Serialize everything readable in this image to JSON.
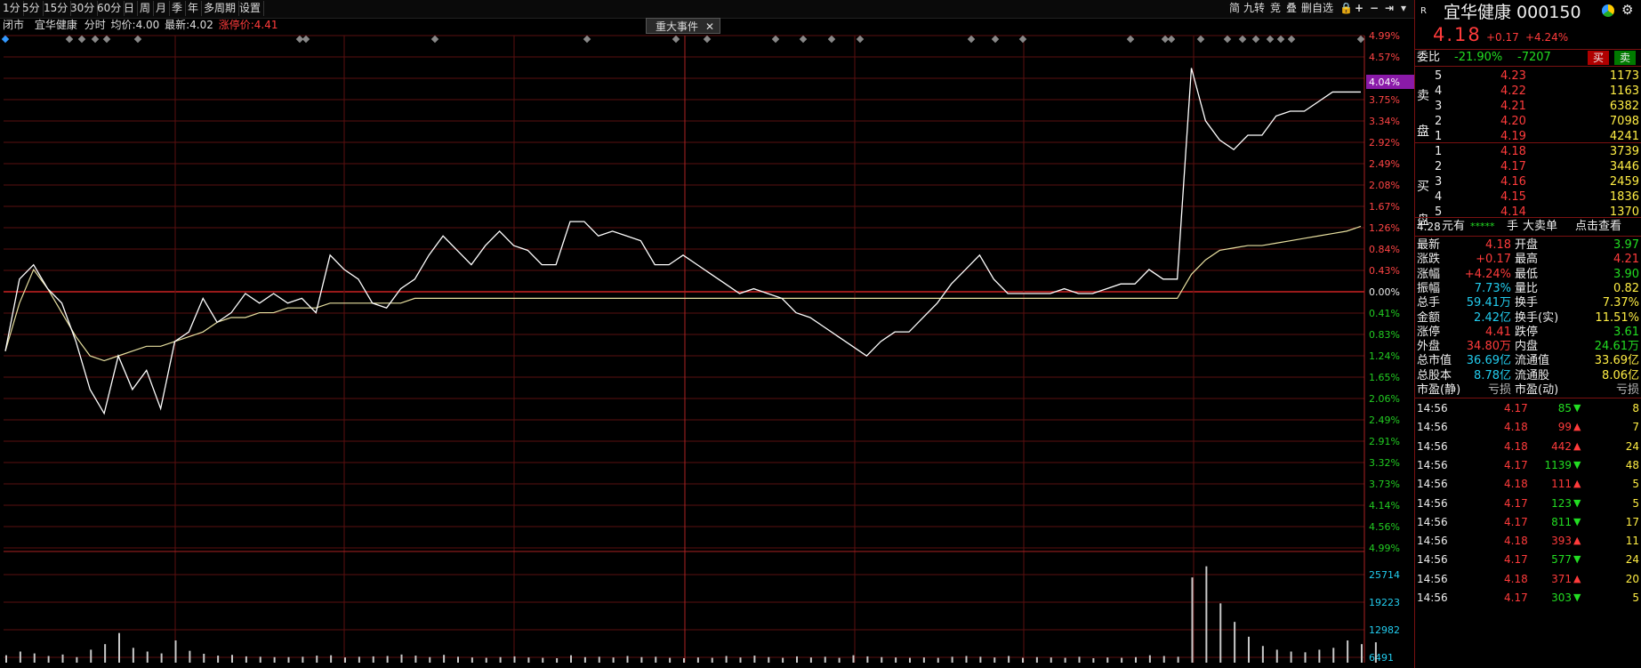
{
  "toolbar": {
    "periods": [
      "1分",
      "5分",
      "15分",
      "30分",
      "60分",
      "日",
      "周",
      "月",
      "季",
      "年",
      "多周期",
      "设置"
    ],
    "right_tools": [
      "简",
      "九转",
      "竞",
      "叠",
      "删自选"
    ]
  },
  "infobar": {
    "mode": "闭市",
    "name": "宜华健康",
    "type": "分时",
    "avg_label": "均价:",
    "avg": "4.00",
    "last_label": "最新:",
    "last": "4.02",
    "limit_label": "涨停价:",
    "limit": "4.41"
  },
  "event_tab": "重大事件",
  "chart_data": {
    "type": "line",
    "title": "",
    "price_axis_labels": [
      "4.99%",
      "4.57%",
      "4.04%",
      "3.75%",
      "3.34%",
      "2.92%",
      "2.49%",
      "2.08%",
      "1.67%",
      "1.26%",
      "0.84%",
      "0.43%",
      "0.00%",
      "0.41%",
      "0.83%",
      "1.24%",
      "1.65%",
      "2.06%",
      "2.49%",
      "2.91%",
      "3.32%",
      "3.73%",
      "4.14%",
      "4.56%",
      "4.99%"
    ],
    "current_label": "4.04%",
    "volume_axis_labels": [
      "25714",
      "19223",
      "12982",
      "6491"
    ],
    "price_y": [
      -1.2,
      0.3,
      0.6,
      0.1,
      -0.2,
      -1.0,
      -2.0,
      -2.5,
      -1.3,
      -2.0,
      -1.6,
      -2.4,
      -1.0,
      -0.8,
      -0.1,
      -0.6,
      -0.4,
      0.0,
      -0.2,
      0.0,
      -0.2,
      -0.1,
      -0.4,
      0.8,
      0.5,
      0.3,
      -0.2,
      -0.3,
      0.1,
      0.3,
      0.8,
      1.2,
      0.9,
      0.6,
      1.0,
      1.3,
      1.0,
      0.9,
      0.6,
      0.6,
      1.5,
      1.5,
      1.2,
      1.3,
      1.2,
      1.1,
      0.6,
      0.6,
      0.8,
      0.6,
      0.4,
      0.2,
      0.0,
      0.1,
      0.0,
      -0.1,
      -0.4,
      -0.5,
      -0.7,
      -0.9,
      -1.1,
      -1.3,
      -1.0,
      -0.8,
      -0.8,
      -0.5,
      -0.2,
      0.2,
      0.5,
      0.8,
      0.3,
      0.0,
      0.0,
      0.0,
      0.0,
      0.1,
      0.0,
      0.0,
      0.1,
      0.2,
      0.2,
      0.5,
      0.3,
      0.3,
      4.7,
      3.6,
      3.2,
      3.0,
      3.3,
      3.3,
      3.7,
      3.8,
      3.8,
      4.0,
      4.2,
      4.2,
      4.2
    ],
    "avg_y": [
      -1.2,
      -0.2,
      0.5,
      0.1,
      -0.4,
      -0.9,
      -1.3,
      -1.4,
      -1.3,
      -1.2,
      -1.1,
      -1.1,
      -1.0,
      -0.9,
      -0.8,
      -0.6,
      -0.5,
      -0.5,
      -0.4,
      -0.4,
      -0.3,
      -0.3,
      -0.3,
      -0.2,
      -0.2,
      -0.2,
      -0.2,
      -0.2,
      -0.2,
      -0.1,
      -0.1,
      -0.1,
      -0.1,
      -0.1,
      -0.1,
      -0.1,
      -0.1,
      -0.1,
      -0.1,
      -0.1,
      -0.1,
      -0.1,
      -0.1,
      -0.1,
      -0.1,
      -0.1,
      -0.1,
      -0.1,
      -0.1,
      -0.1,
      -0.1,
      -0.1,
      -0.1,
      -0.1,
      -0.1,
      -0.1,
      -0.1,
      -0.1,
      -0.1,
      -0.1,
      -0.1,
      -0.1,
      -0.1,
      -0.1,
      -0.1,
      -0.1,
      -0.1,
      -0.1,
      -0.1,
      -0.1,
      -0.1,
      -0.1,
      -0.1,
      -0.1,
      -0.1,
      -0.1,
      -0.1,
      -0.1,
      -0.1,
      -0.1,
      -0.1,
      -0.1,
      -0.1,
      -0.1,
      0.4,
      0.7,
      0.9,
      0.95,
      1.0,
      1.0,
      1.05,
      1.1,
      1.15,
      1.2,
      1.25,
      1.3,
      1.4
    ],
    "volume": [
      2000,
      3000,
      2500,
      1800,
      2200,
      1500,
      3500,
      5000,
      8000,
      4000,
      3000,
      2500,
      6000,
      3200,
      2400,
      1900,
      2100,
      1700,
      1600,
      1500,
      1500,
      1600,
      1900,
      2000,
      1400,
      1600,
      1700,
      1800,
      2200,
      1900,
      1500,
      2100,
      1600,
      1400,
      1300,
      1500,
      1700,
      1400,
      1300,
      1200,
      2000,
      1500,
      1600,
      1400,
      1800,
      1500,
      1600,
      1300,
      1200,
      1400,
      1300,
      1800,
      1400,
      1900,
      1500,
      1300,
      1700,
      1400,
      1600,
      1300,
      2000,
      1700,
      1500,
      1400,
      1300,
      1400,
      1300,
      1600,
      1800,
      1600,
      1400,
      1800,
      1300,
      1500,
      1400,
      1300,
      1600,
      1200,
      1400,
      1300,
      1500,
      2000,
      1800,
      1600,
      23000,
      26000,
      16000,
      11000,
      7000,
      4500,
      3500,
      3000,
      2800,
      3500,
      4000,
      6000,
      5000,
      5500
    ],
    "ylim": [
      -5,
      5
    ]
  },
  "panel": {
    "badge": "R",
    "title": "宜华健康 000150",
    "price": "4.18",
    "change": "+0.17",
    "change_pct": "+4.24%",
    "weibi_label": "委比",
    "weibi_pct": "-21.90%",
    "weibi_val": "-7207",
    "buy_btn": "买",
    "sell_btn": "卖",
    "sell_label": [
      "卖",
      "盘"
    ],
    "buy_label": [
      "买",
      "盘"
    ],
    "asks": [
      {
        "lvl": "5",
        "price": "4.23",
        "vol": "1173"
      },
      {
        "lvl": "4",
        "price": "4.22",
        "vol": "1163"
      },
      {
        "lvl": "3",
        "price": "4.21",
        "vol": "6382"
      },
      {
        "lvl": "2",
        "price": "4.20",
        "vol": "7098"
      },
      {
        "lvl": "1",
        "price": "4.19",
        "vol": "4241"
      }
    ],
    "bids": [
      {
        "lvl": "1",
        "price": "4.18",
        "vol": "3739"
      },
      {
        "lvl": "2",
        "price": "4.17",
        "vol": "3446"
      },
      {
        "lvl": "3",
        "price": "4.16",
        "vol": "2459"
      },
      {
        "lvl": "4",
        "price": "4.15",
        "vol": "1836"
      },
      {
        "lvl": "5",
        "price": "4.14",
        "vol": "1370"
      }
    ],
    "bigorder": {
      "price": "4.28",
      "unit": "元有",
      "stars": "*****",
      "hand": "手",
      "big": "大卖单",
      "link": "点击查看"
    },
    "stats": [
      [
        "最新",
        "4.18",
        "red",
        "开盘",
        "3.97",
        "green"
      ],
      [
        "涨跌",
        "+0.17",
        "red",
        "最高",
        "4.21",
        "red"
      ],
      [
        "涨幅",
        "+4.24%",
        "red",
        "最低",
        "3.90",
        "green"
      ],
      [
        "振幅",
        "7.73%",
        "cyan",
        "量比",
        "0.82",
        "yellow"
      ],
      [
        "总手",
        "59.41万",
        "cyan",
        "换手",
        "7.37%",
        "yellow"
      ],
      [
        "金额",
        "2.42亿",
        "cyan",
        "换手(实)",
        "11.51%",
        "yellow"
      ],
      [
        "涨停",
        "4.41",
        "red",
        "跌停",
        "3.61",
        "green"
      ],
      [
        "外盘",
        "34.80万",
        "red",
        "内盘",
        "24.61万",
        "green"
      ],
      [
        "总市值",
        "36.69亿",
        "cyan",
        "流通值",
        "33.69亿",
        "yellow"
      ],
      [
        "总股本",
        "8.78亿",
        "cyan",
        "流通股",
        "8.06亿",
        "yellow"
      ],
      [
        "市盈(静)",
        "亏损",
        "gray",
        "市盈(动)",
        "亏损",
        "gray"
      ]
    ],
    "ticks": [
      {
        "t": "14:56",
        "p": "4.17",
        "v": "85",
        "d": "down",
        "n": "8"
      },
      {
        "t": "14:56",
        "p": "4.18",
        "v": "99",
        "d": "up",
        "n": "7"
      },
      {
        "t": "14:56",
        "p": "4.18",
        "v": "442",
        "d": "up",
        "n": "24"
      },
      {
        "t": "14:56",
        "p": "4.17",
        "v": "1139",
        "d": "down",
        "n": "48"
      },
      {
        "t": "14:56",
        "p": "4.18",
        "v": "111",
        "d": "up",
        "n": "5"
      },
      {
        "t": "14:56",
        "p": "4.17",
        "v": "123",
        "d": "down",
        "n": "5"
      },
      {
        "t": "14:56",
        "p": "4.17",
        "v": "811",
        "d": "down",
        "n": "17"
      },
      {
        "t": "14:56",
        "p": "4.18",
        "v": "393",
        "d": "up",
        "n": "11"
      },
      {
        "t": "14:56",
        "p": "4.17",
        "v": "577",
        "d": "down",
        "n": "24"
      },
      {
        "t": "14:56",
        "p": "4.18",
        "v": "371",
        "d": "up",
        "n": "20"
      },
      {
        "t": "14:56",
        "p": "4.17",
        "v": "303",
        "d": "down",
        "n": "5"
      }
    ]
  }
}
